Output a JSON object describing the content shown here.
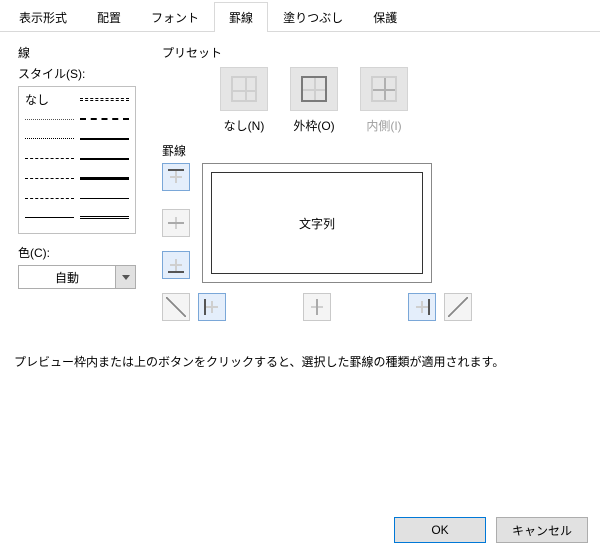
{
  "tabs": {
    "display": "表示形式",
    "alignment": "配置",
    "font": "フォント",
    "border": "罫線",
    "fill": "塗りつぶし",
    "protection": "保護"
  },
  "line_section": {
    "title": "線",
    "style_label": "スタイル(S):",
    "none_label": "なし",
    "color_label": "色(C):",
    "color_value": "自動"
  },
  "preset_section": {
    "title": "プリセット",
    "none": "なし(N)",
    "outline": "外枠(O)",
    "inside": "内側(I)"
  },
  "border_section": {
    "title": "罫線",
    "preview_text": "文字列"
  },
  "note": "プレビュー枠内または上のボタンをクリックすると、選択した罫線の種類が適用されます。",
  "buttons": {
    "ok": "OK",
    "cancel": "キャンセル"
  }
}
